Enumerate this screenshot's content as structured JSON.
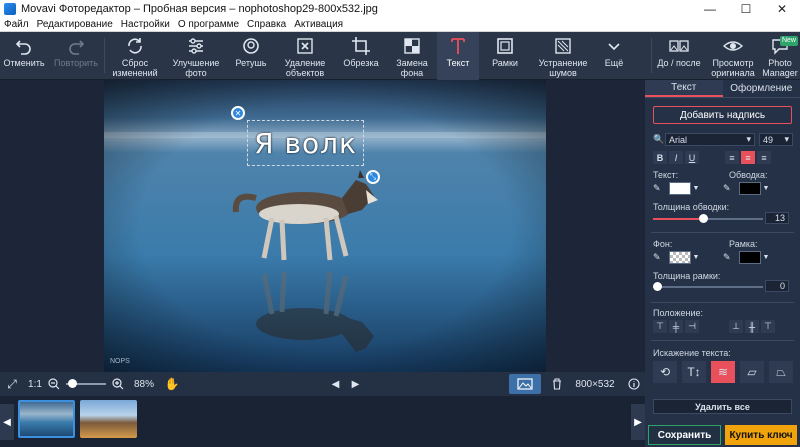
{
  "window": {
    "title": "Movavi Фоторедактор – Пробная версия – nophotoshop29-800x532.jpg",
    "minimize": "—",
    "maximize": "☐",
    "close": "✕"
  },
  "menu": [
    "Файл",
    "Редактирование",
    "Настройки",
    "О программе",
    "Справка",
    "Активация"
  ],
  "toolbar": {
    "undo": "Отменить",
    "redo": "Повторить",
    "reset": "Сброс\nизменений",
    "enhance": "Улучшение\nфото",
    "retouch": "Ретушь",
    "remove_objects": "Удаление\nобъектов",
    "crop": "Обрезка",
    "replace_bg": "Замена\nфона",
    "text": "Текст",
    "frames": "Рамки",
    "denoise": "Устранение\nшумов",
    "more": "Ещё",
    "before_after": "До / после",
    "preview": "Просмотр\nоригинала",
    "photo_manager": "Photo\nManager",
    "new_badge": "New"
  },
  "canvas": {
    "text_overlay": "Я волк",
    "watermark": "NOPS"
  },
  "status": {
    "fit": "⤢",
    "one_to_one": "1:1",
    "zoom": "88%",
    "dimensions": "800×532",
    "prev": "◀",
    "next": "▶"
  },
  "panel": {
    "tab_text": "Текст",
    "tab_style": "Оформление",
    "add_caption": "Добавить надпись",
    "font": "Arial",
    "font_size": "49",
    "text_label": "Текст:",
    "outline_label": "Обводка:",
    "outline_thickness_label": "Толщина обводки:",
    "outline_thickness": "13",
    "background_label": "Фон:",
    "frame_label": "Рамка:",
    "frame_thickness_label": "Толщина рамки:",
    "frame_thickness": "0",
    "position_label": "Положение:",
    "distortion_label": "Искажение текста:",
    "delete_all": "Удалить все",
    "save": "Сохранить",
    "buy": "Купить ключ",
    "outline_fraction": 0.45,
    "frame_fraction": 0.0
  },
  "colors": {
    "accent": "#e8505b",
    "buy": "#f0a30a",
    "save_border": "#2ea36a"
  }
}
